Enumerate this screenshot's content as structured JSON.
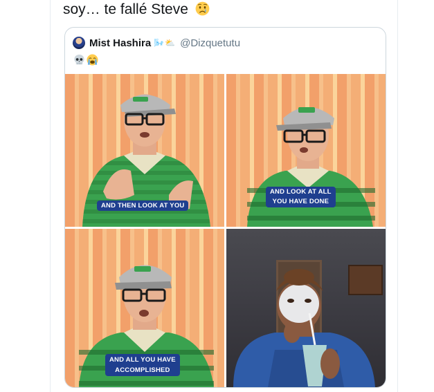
{
  "tweet": {
    "text": "soy… te fallé Steve",
    "emoji": "crying-face"
  },
  "quoted_tweet": {
    "display_name": "Mist Hashira",
    "name_emojis": "🌬️⛅",
    "handle": "@Dizquetutu",
    "emojis": [
      "skull",
      "loudly-crying-face"
    ]
  },
  "media": {
    "panels": [
      {
        "caption_lines": [
          "AND THEN LOOK AT YOU"
        ]
      },
      {
        "caption_lines": [
          "AND LOOK AT ALL",
          "YOU HAVE DONE"
        ]
      },
      {
        "caption_lines": [
          "AND ALL YOU HAVE",
          "ACCOMPLISHED"
        ]
      },
      {
        "caption_lines": []
      }
    ]
  },
  "colors": {
    "text": "#14171a",
    "secondary": "#657786",
    "border": "#ccd6dd",
    "caption_bg": "#1f3f8f",
    "shirt_green": "#3aa24f",
    "stripe_orange": "#f2a06a"
  }
}
